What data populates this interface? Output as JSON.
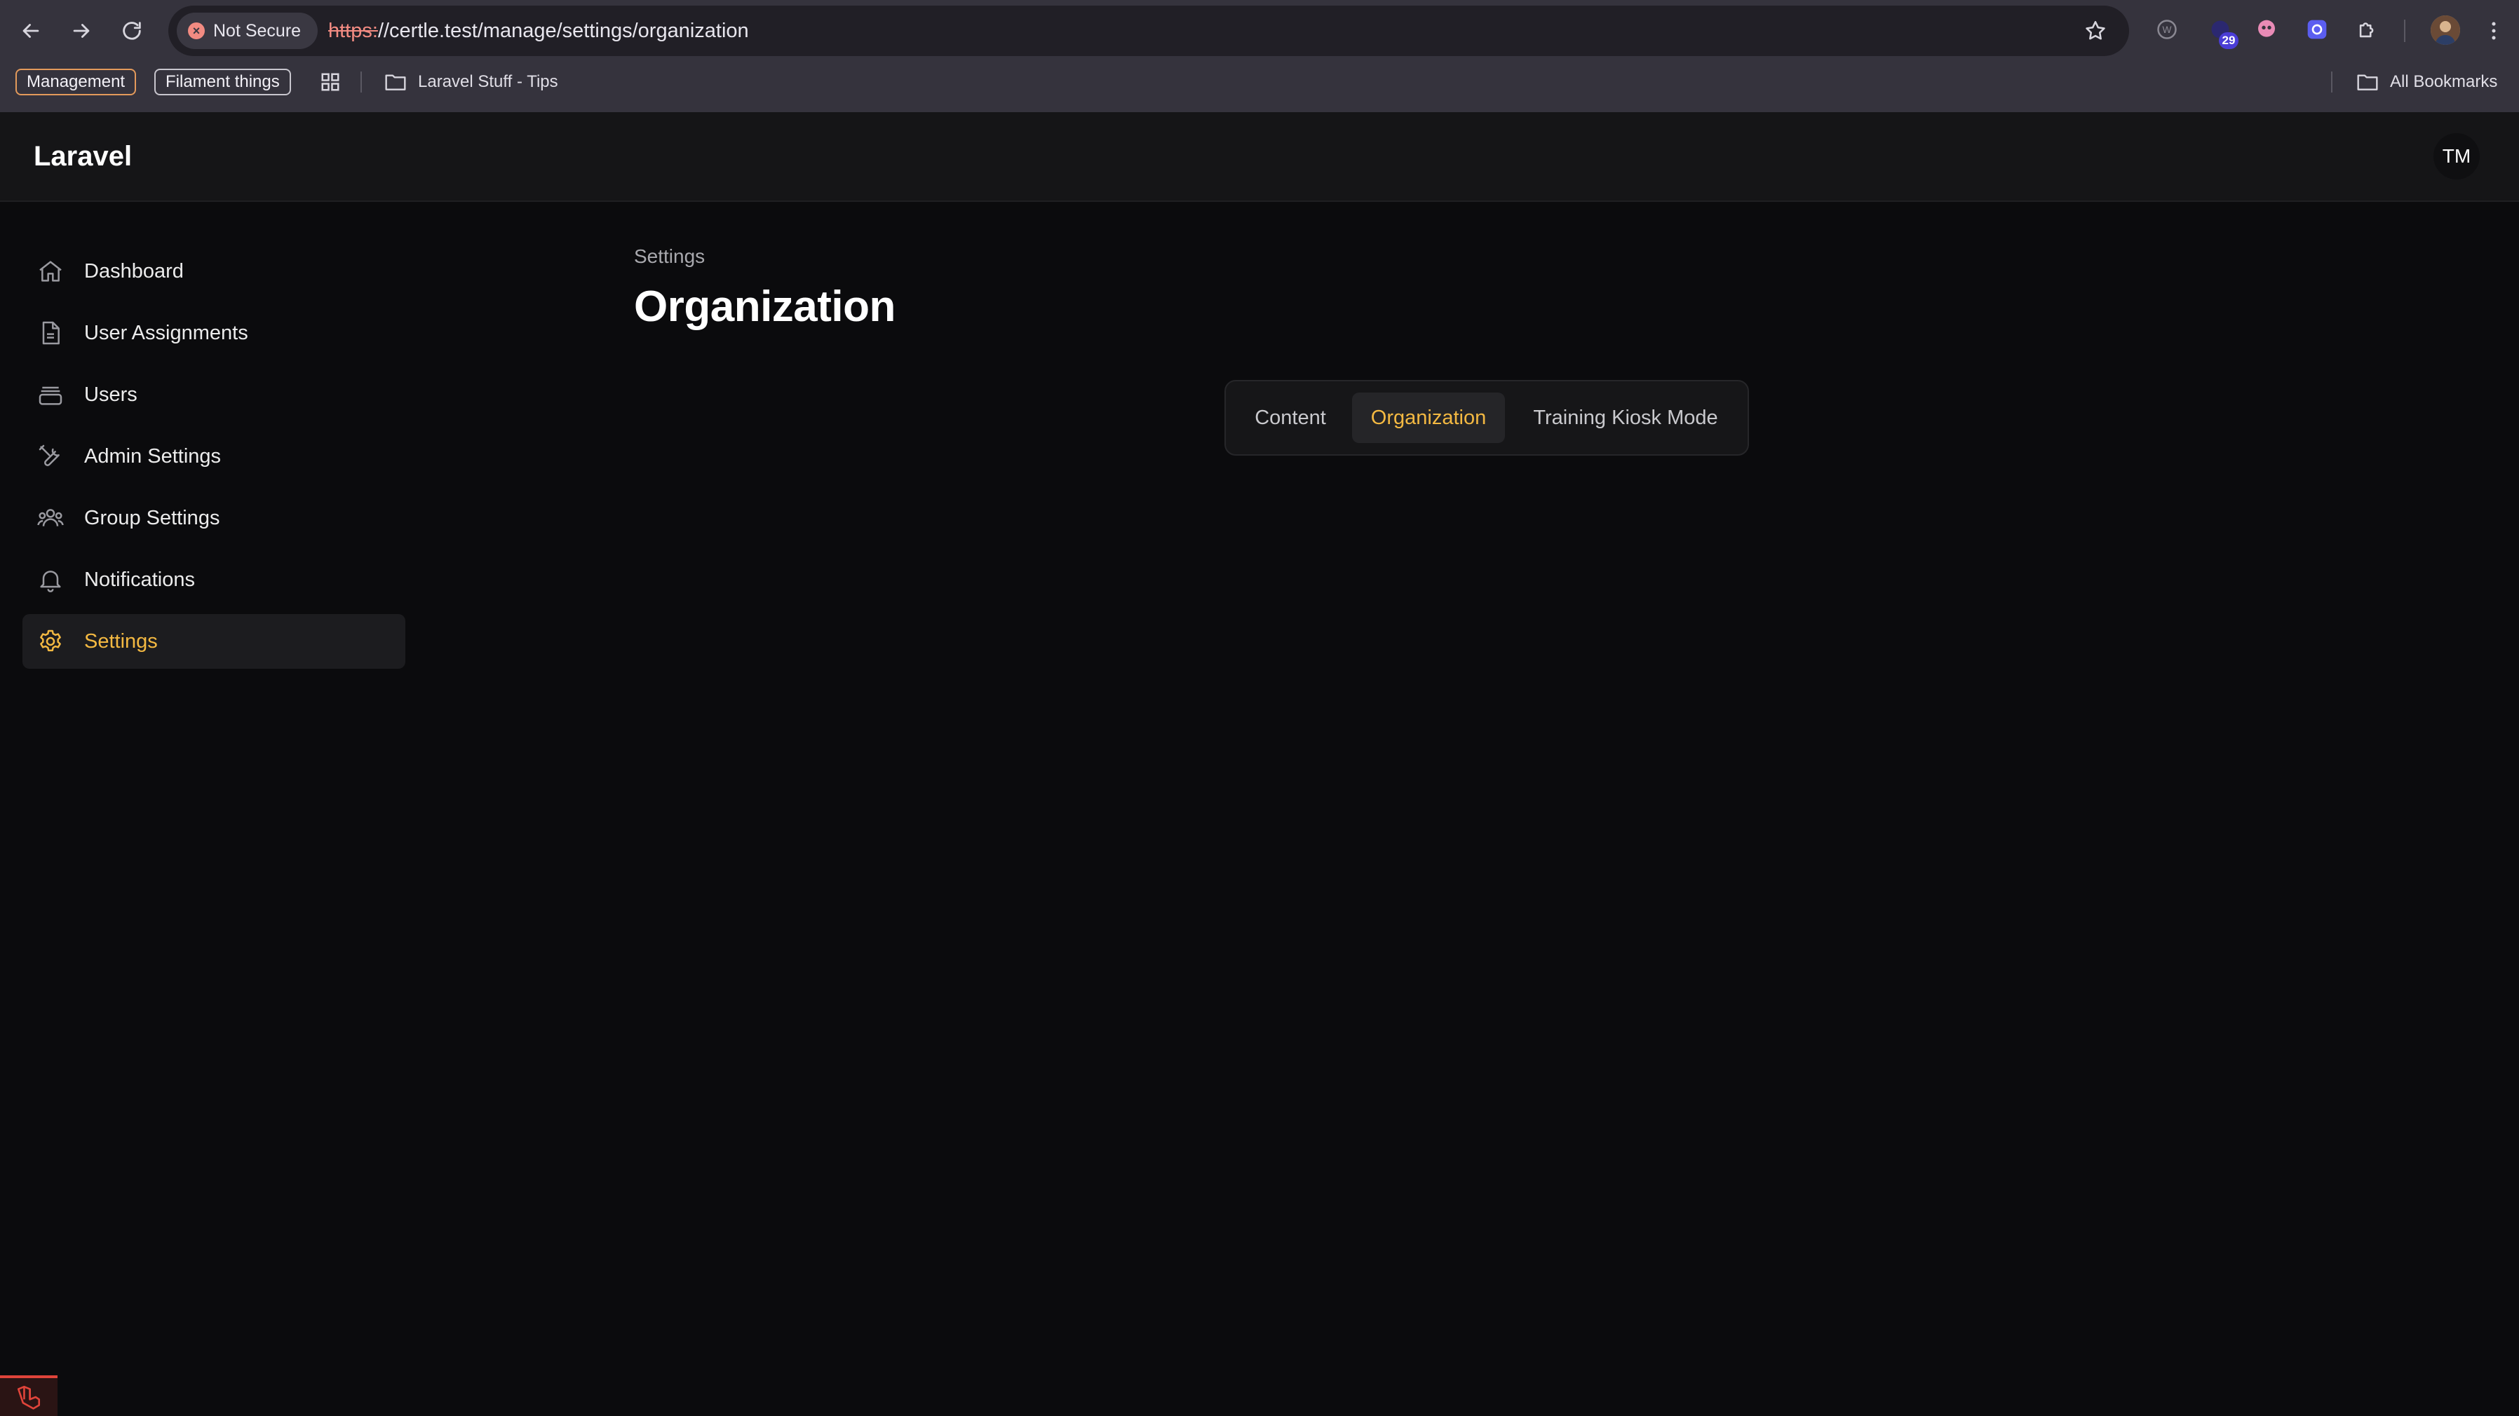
{
  "browser": {
    "security_label": "Not Secure",
    "url_scheme": "https:",
    "url_rest": "//certle.test/manage/settings/organization",
    "extension_badge": "29",
    "bookmarks": [
      {
        "label": "Management"
      },
      {
        "label": "Filament things"
      }
    ],
    "bookmark_folder": "Laravel Stuff - Tips",
    "all_bookmarks": "All Bookmarks"
  },
  "header": {
    "brand": "Laravel",
    "user_initials": "TM"
  },
  "sidebar": {
    "items": [
      {
        "label": "Dashboard",
        "icon": "home-icon"
      },
      {
        "label": "User Assignments",
        "icon": "document-icon"
      },
      {
        "label": "Users",
        "icon": "inbox-stack-icon"
      },
      {
        "label": "Admin Settings",
        "icon": "wrench-screwdriver-icon"
      },
      {
        "label": "Group Settings",
        "icon": "user-group-icon"
      },
      {
        "label": "Notifications",
        "icon": "bell-icon"
      },
      {
        "label": "Settings",
        "icon": "cog-icon",
        "active": true
      }
    ]
  },
  "main": {
    "breadcrumb": "Settings",
    "title": "Organization",
    "tabs": [
      {
        "label": "Content"
      },
      {
        "label": "Organization",
        "active": true
      },
      {
        "label": "Training Kiosk Mode"
      }
    ]
  },
  "colors": {
    "accent": "#f4b942",
    "background": "#0b0b0d",
    "header_bg": "#151517",
    "chrome_bg": "#35333d"
  }
}
